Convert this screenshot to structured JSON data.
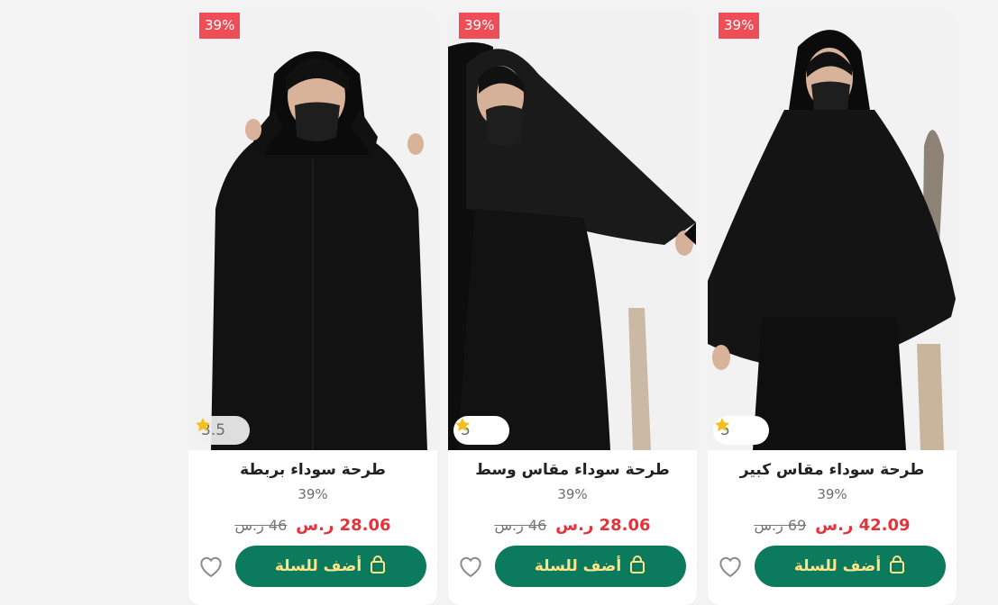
{
  "currency": "ر.س",
  "products": [
    {
      "title": "طرحة سوداء بربطة",
      "discount": "39%",
      "discount_text": "39%",
      "rating": "3.5",
      "price": "28.06",
      "old_price": "46",
      "cta": "أضف للسلة"
    },
    {
      "title": "طرحة سوداء مقاس وسط",
      "discount": "39%",
      "discount_text": "39%",
      "rating": "5",
      "price": "28.06",
      "old_price": "46",
      "cta": "أضف للسلة"
    },
    {
      "title": "طرحة سوداء مقاس كبير",
      "discount": "39%",
      "discount_text": "39%",
      "rating": "5",
      "price": "42.09",
      "old_price": "69",
      "cta": "أضف للسلة"
    }
  ],
  "colors": {
    "badge": "#ef4e58",
    "button": "#0c7a5c",
    "button_text": "#ffe38a",
    "price": "#e3343c"
  },
  "icons": {
    "rating": "star-icon",
    "button": "lock-bag-icon",
    "wishlist": "heart-icon"
  }
}
